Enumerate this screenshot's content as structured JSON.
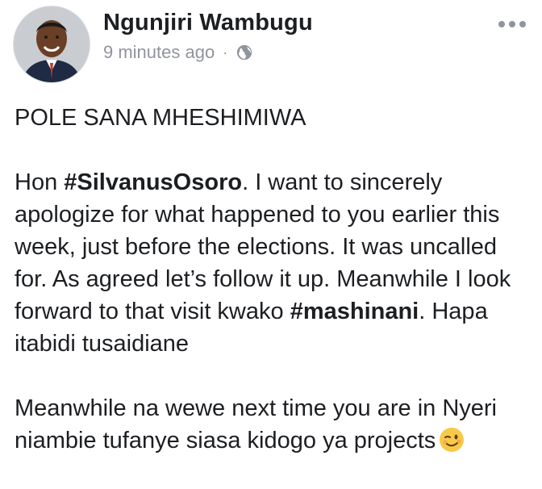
{
  "post": {
    "author": "Ngunjiri Wambugu",
    "timestamp": "9 minutes ago",
    "separator": "·",
    "privacy_icon": "globe-icon",
    "paragraphs": {
      "p1": "POLE SANA MHESHIMIWA",
      "p2_a": "Hon ",
      "p2_tag1": "#SilvanusOsoro",
      "p2_b": ". I want to sincerely apologize for what happened to you earlier this week, just before the elections. It was uncalled for. As agreed let’s follow it up. Meanwhile I look forward to that visit kwako ",
      "p2_tag2": "#mashinani",
      "p2_c": ". Hapa itabidi tusaidiane",
      "p3": "Meanwhile na wewe next time you are in Nyeri niambie tufanye siasa kidogo ya projects"
    },
    "emoji_icon": "winking-face-emoji"
  }
}
